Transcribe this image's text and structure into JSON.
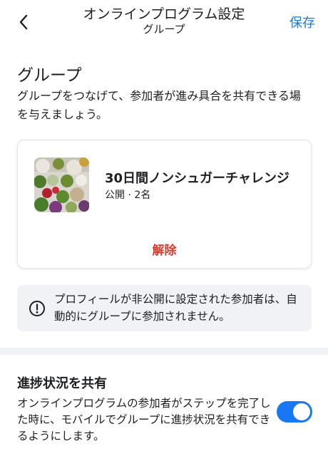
{
  "header": {
    "title": "オンラインプログラム設定",
    "subtitle": "グループ",
    "save_label": "保存",
    "back_icon": "chevron-left-icon"
  },
  "group_section": {
    "title": "グループ",
    "description": "グループをつなげて、参加者が進み具合を共有できる場を与えましょう。"
  },
  "group_card": {
    "name": "30日間ノンシュガーチャレンジ",
    "meta": "公開 · 2名",
    "remove_label": "解除",
    "remove_color": "#e0382b"
  },
  "notice": {
    "icon": "info-icon",
    "text": "プロフィールが非公開に設定された参加者は、自動的にグループに参加されません。"
  },
  "share_section": {
    "title": "進捗状況を共有",
    "description": "オンラインプログラムの参加者がステップを完了した時に、モバイルでグループに進捗状況を共有できるようにします。",
    "toggle_on": true
  },
  "colors": {
    "accent": "#1877f2",
    "danger": "#e0382b",
    "notice_bg": "#f0f2f5"
  }
}
